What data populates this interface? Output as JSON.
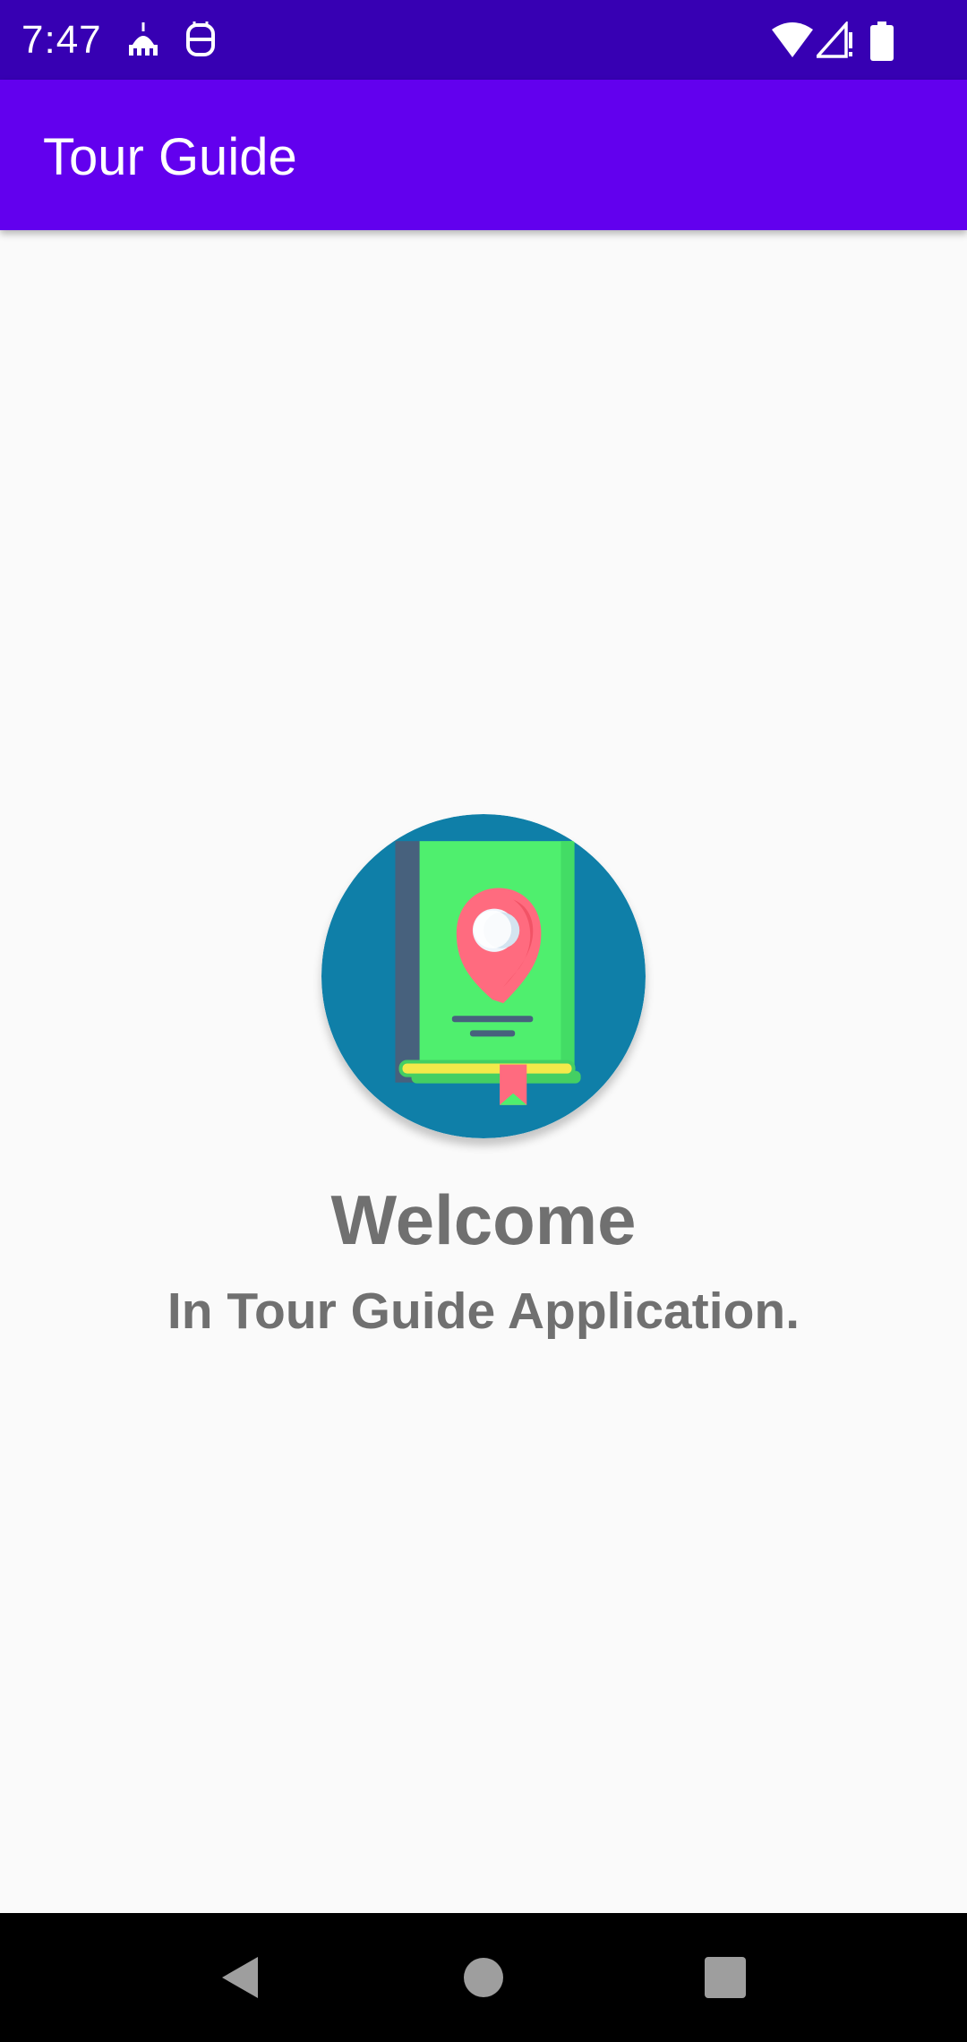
{
  "status_bar": {
    "time": "7:47",
    "left_icons": [
      "mosque-icon",
      "keyboard-face-icon"
    ],
    "right_icons": [
      "wifi-icon",
      "signal-icon",
      "battery-icon"
    ]
  },
  "app_bar": {
    "title": "Tour Guide"
  },
  "main": {
    "logo_icon": "book-map-pin-icon",
    "title": "Welcome",
    "subtitle": "In Tour Guide Application."
  },
  "nav_bar": {
    "buttons": [
      "back-icon",
      "home-icon",
      "recents-icon"
    ]
  },
  "colors": {
    "status_bar": "#3700b3",
    "app_bar": "#6200ee",
    "background": "#fafafa",
    "text": "#707070",
    "logo_circle": "#0f7fa8",
    "book": "#4fef6e",
    "pin": "#ff6b7f"
  }
}
